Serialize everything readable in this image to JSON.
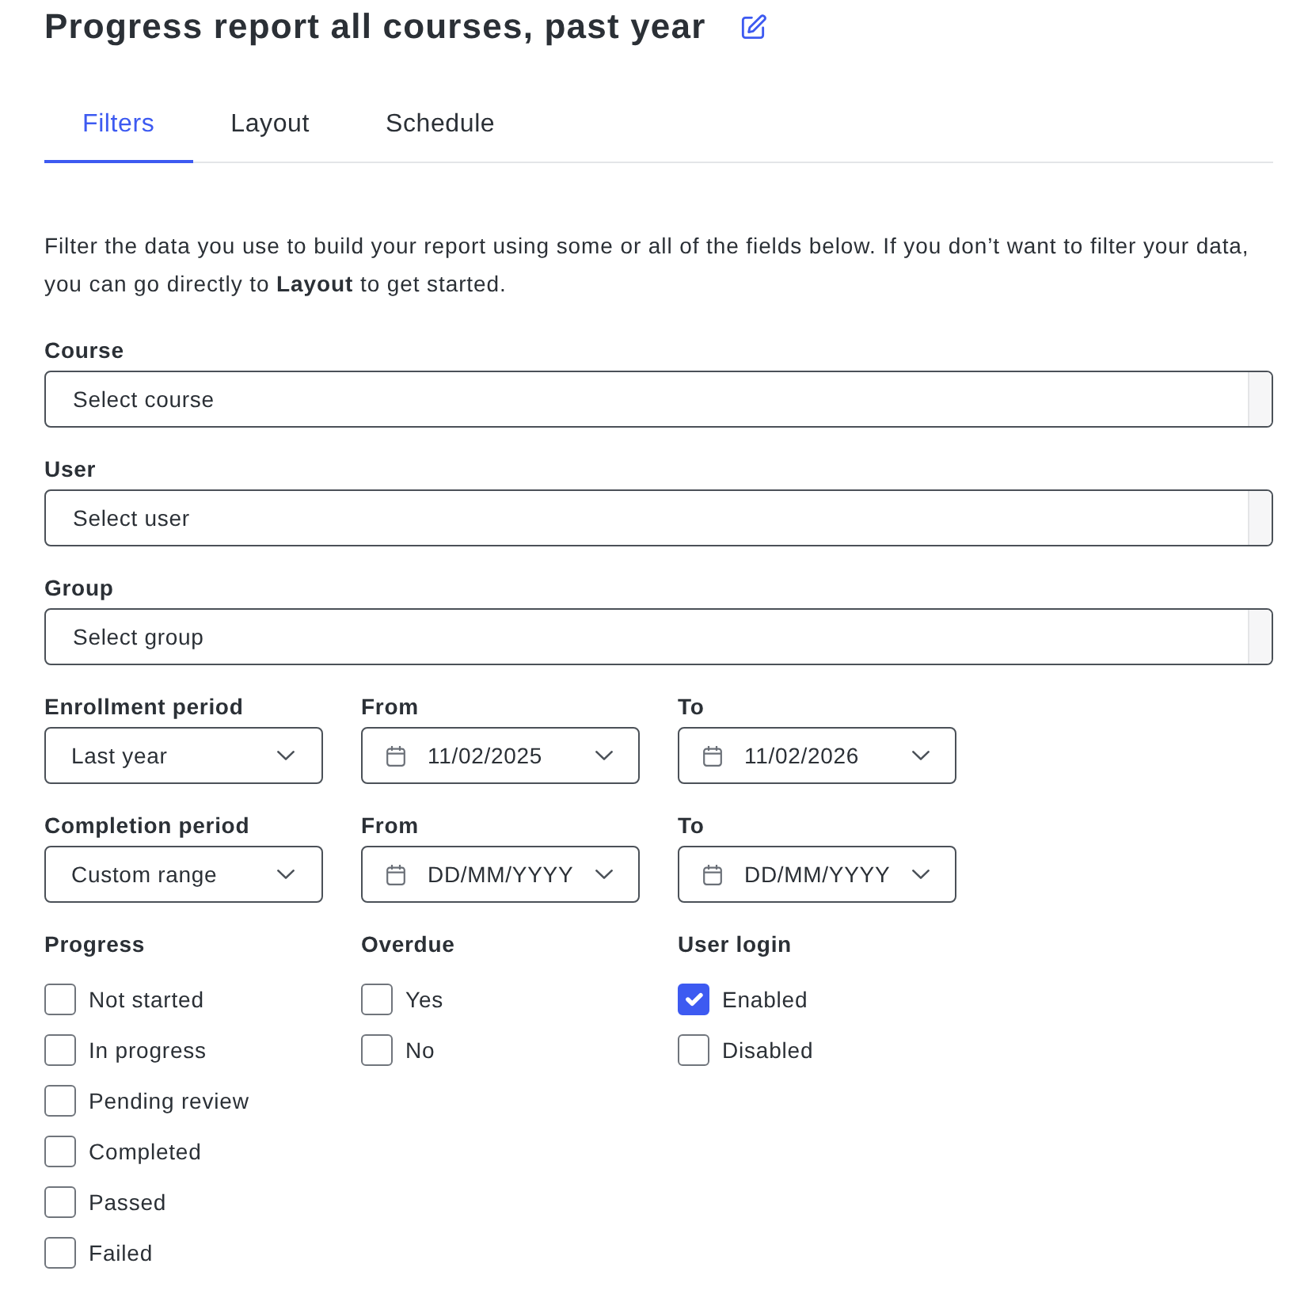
{
  "title": "Progress report all courses, past year",
  "tabs": [
    {
      "label": "Filters",
      "selected": true
    },
    {
      "label": "Layout",
      "selected": false
    },
    {
      "label": "Schedule",
      "selected": false
    }
  ],
  "intro": "Filter the data you use to build your report using some or all of the fields below. If you don’t want to filter your data, you can go directly to **Layout** to get started.",
  "fields": [
    {
      "label": "Course",
      "placeholder": "Select course"
    },
    {
      "label": "User",
      "placeholder": "Select user"
    },
    {
      "label": "Group",
      "placeholder": "Select group"
    }
  ],
  "periods": [
    {
      "label": "Enrollment period",
      "range": "Last year",
      "dates": [
        {
          "label": "From",
          "value": "11/02/2025"
        },
        {
          "label": "To",
          "value": "11/02/2026"
        }
      ]
    },
    {
      "label": "Completion period",
      "range": "Custom range",
      "dates": [
        {
          "label": "From",
          "placeholder": "DD/MM/YYYY"
        },
        {
          "label": "To",
          "placeholder": "DD/MM/YYYY"
        }
      ]
    }
  ],
  "checkbox_groups": [
    {
      "label": "Progress",
      "options": [
        {
          "label": "Not started",
          "checked": false
        },
        {
          "label": "In progress",
          "checked": false
        },
        {
          "label": "Pending review",
          "checked": false
        },
        {
          "label": "Completed",
          "checked": false
        },
        {
          "label": "Passed",
          "checked": false
        },
        {
          "label": "Failed",
          "checked": false
        }
      ]
    },
    {
      "label": "Overdue",
      "options": [
        {
          "label": "Yes",
          "checked": false
        },
        {
          "label": "No",
          "checked": false
        }
      ]
    },
    {
      "label": "User login",
      "options": [
        {
          "label": "Enabled",
          "checked": true
        },
        {
          "label": "Disabled",
          "checked": false
        }
      ]
    }
  ]
}
